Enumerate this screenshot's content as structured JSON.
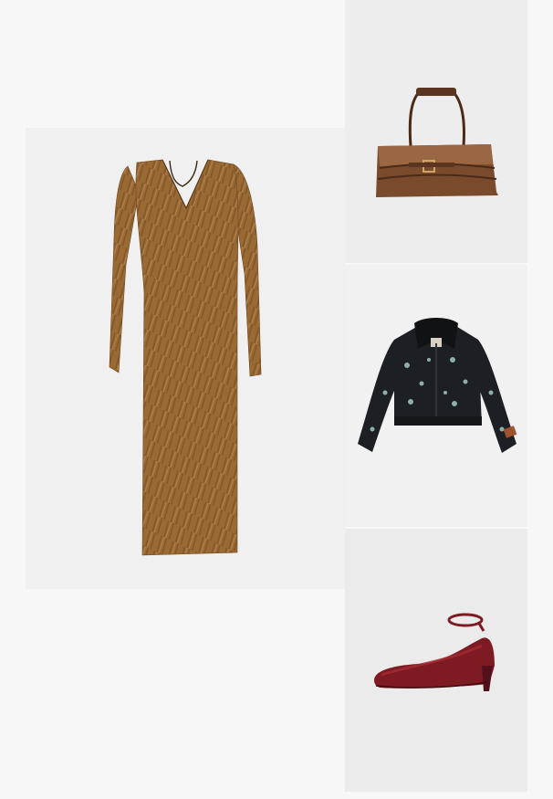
{
  "products": [
    {
      "id": "dress",
      "name": "",
      "colors": {
        "base": "#9a6a34",
        "dark": "#6e4620",
        "light": "#c39563"
      }
    },
    {
      "id": "bag",
      "name": "",
      "colors": {
        "base": "#7a4a2c",
        "dark": "#4b2a17",
        "light": "#9a6644"
      }
    },
    {
      "id": "jacket",
      "name": "",
      "colors": {
        "base": "#1c1f24",
        "collar": "#111214",
        "flower": "#8fb0a8",
        "patch": "#a0522d"
      }
    },
    {
      "id": "shoe",
      "name": "",
      "colors": {
        "base": "#7e1a22",
        "dark": "#52101a",
        "light": "#a32c34"
      }
    }
  ]
}
